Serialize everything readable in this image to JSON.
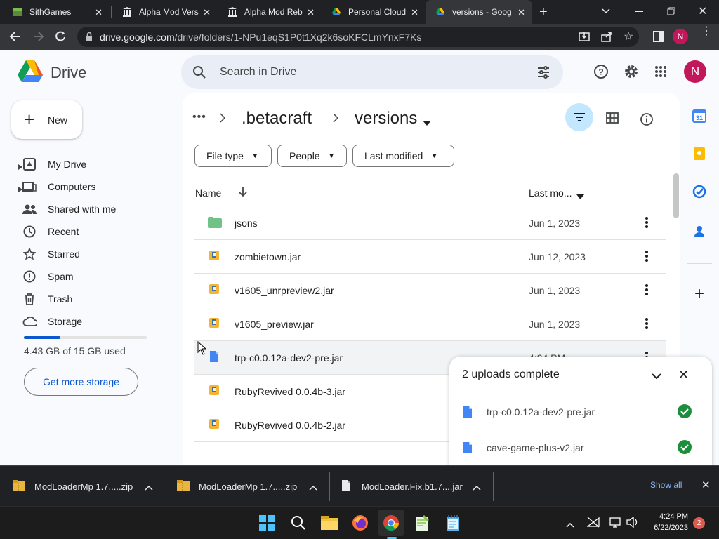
{
  "browser": {
    "tabs": [
      {
        "title": "SithGames",
        "active": false
      },
      {
        "title": "Alpha Mod Vers",
        "active": false
      },
      {
        "title": "Alpha Mod Reb",
        "active": false
      },
      {
        "title": "Personal Cloud",
        "active": false
      },
      {
        "title": "versions - Goog",
        "active": true
      }
    ],
    "url": "drive.google.com/drive/folders/1-NPu1eqS1P0t1Xq2k6soKFCLmYnxF7Ks",
    "profile_initial": "N"
  },
  "drive": {
    "logo_text": "Drive",
    "search_placeholder": "Search in Drive",
    "avatar_initial": "N",
    "new_button": "New",
    "nav": [
      {
        "label": "My Drive",
        "icon": "my-drive-icon"
      },
      {
        "label": "Computers",
        "icon": "computers-icon"
      },
      {
        "label": "Shared with me",
        "icon": "shared-icon"
      },
      {
        "label": "Recent",
        "icon": "recent-icon"
      },
      {
        "label": "Starred",
        "icon": "star-icon"
      },
      {
        "label": "Spam",
        "icon": "spam-icon"
      },
      {
        "label": "Trash",
        "icon": "trash-icon"
      },
      {
        "label": "Storage",
        "icon": "cloud-icon"
      }
    ],
    "storage_used_text": "4.43 GB of 15 GB used",
    "storage_fraction": 0.295,
    "get_storage_button": "Get more storage",
    "breadcrumb": {
      "ellipsis": "•••",
      "parent": ".betacraft",
      "current": "versions"
    },
    "filters": [
      "File type",
      "People",
      "Last modified"
    ],
    "columns": {
      "name": "Name",
      "last_modified": "Last mo..."
    },
    "files": [
      {
        "name": "jsons",
        "date": "Jun 1, 2023",
        "type": "folder"
      },
      {
        "name": "zombietown.jar",
        "date": "Jun 12, 2023",
        "type": "jar"
      },
      {
        "name": "v1605_unrpreview2.jar",
        "date": "Jun 1, 2023",
        "type": "jar"
      },
      {
        "name": "v1605_preview.jar",
        "date": "Jun 1, 2023",
        "type": "jar"
      },
      {
        "name": "trp-c0.0.12a-dev2-pre.jar",
        "date": "4:24 PM",
        "type": "doc"
      },
      {
        "name": "RubyRevived 0.0.4b-3.jar",
        "date": "",
        "type": "jar"
      },
      {
        "name": "RubyRevived 0.0.4b-2.jar",
        "date": "",
        "type": "jar"
      }
    ],
    "upload_panel": {
      "title": "2 uploads complete",
      "items": [
        "trp-c0.0.12a-dev2-pre.jar",
        "cave-game-plus-v2.jar"
      ]
    }
  },
  "downloads": {
    "items": [
      "ModLoaderMp 1.7.....zip",
      "ModLoaderMp 1.7.....zip",
      "ModLoader.Fix.b1.7....jar"
    ],
    "show_all": "Show all"
  },
  "taskbar": {
    "time": "4:24 PM",
    "date": "6/22/2023",
    "notification_count": "2"
  }
}
